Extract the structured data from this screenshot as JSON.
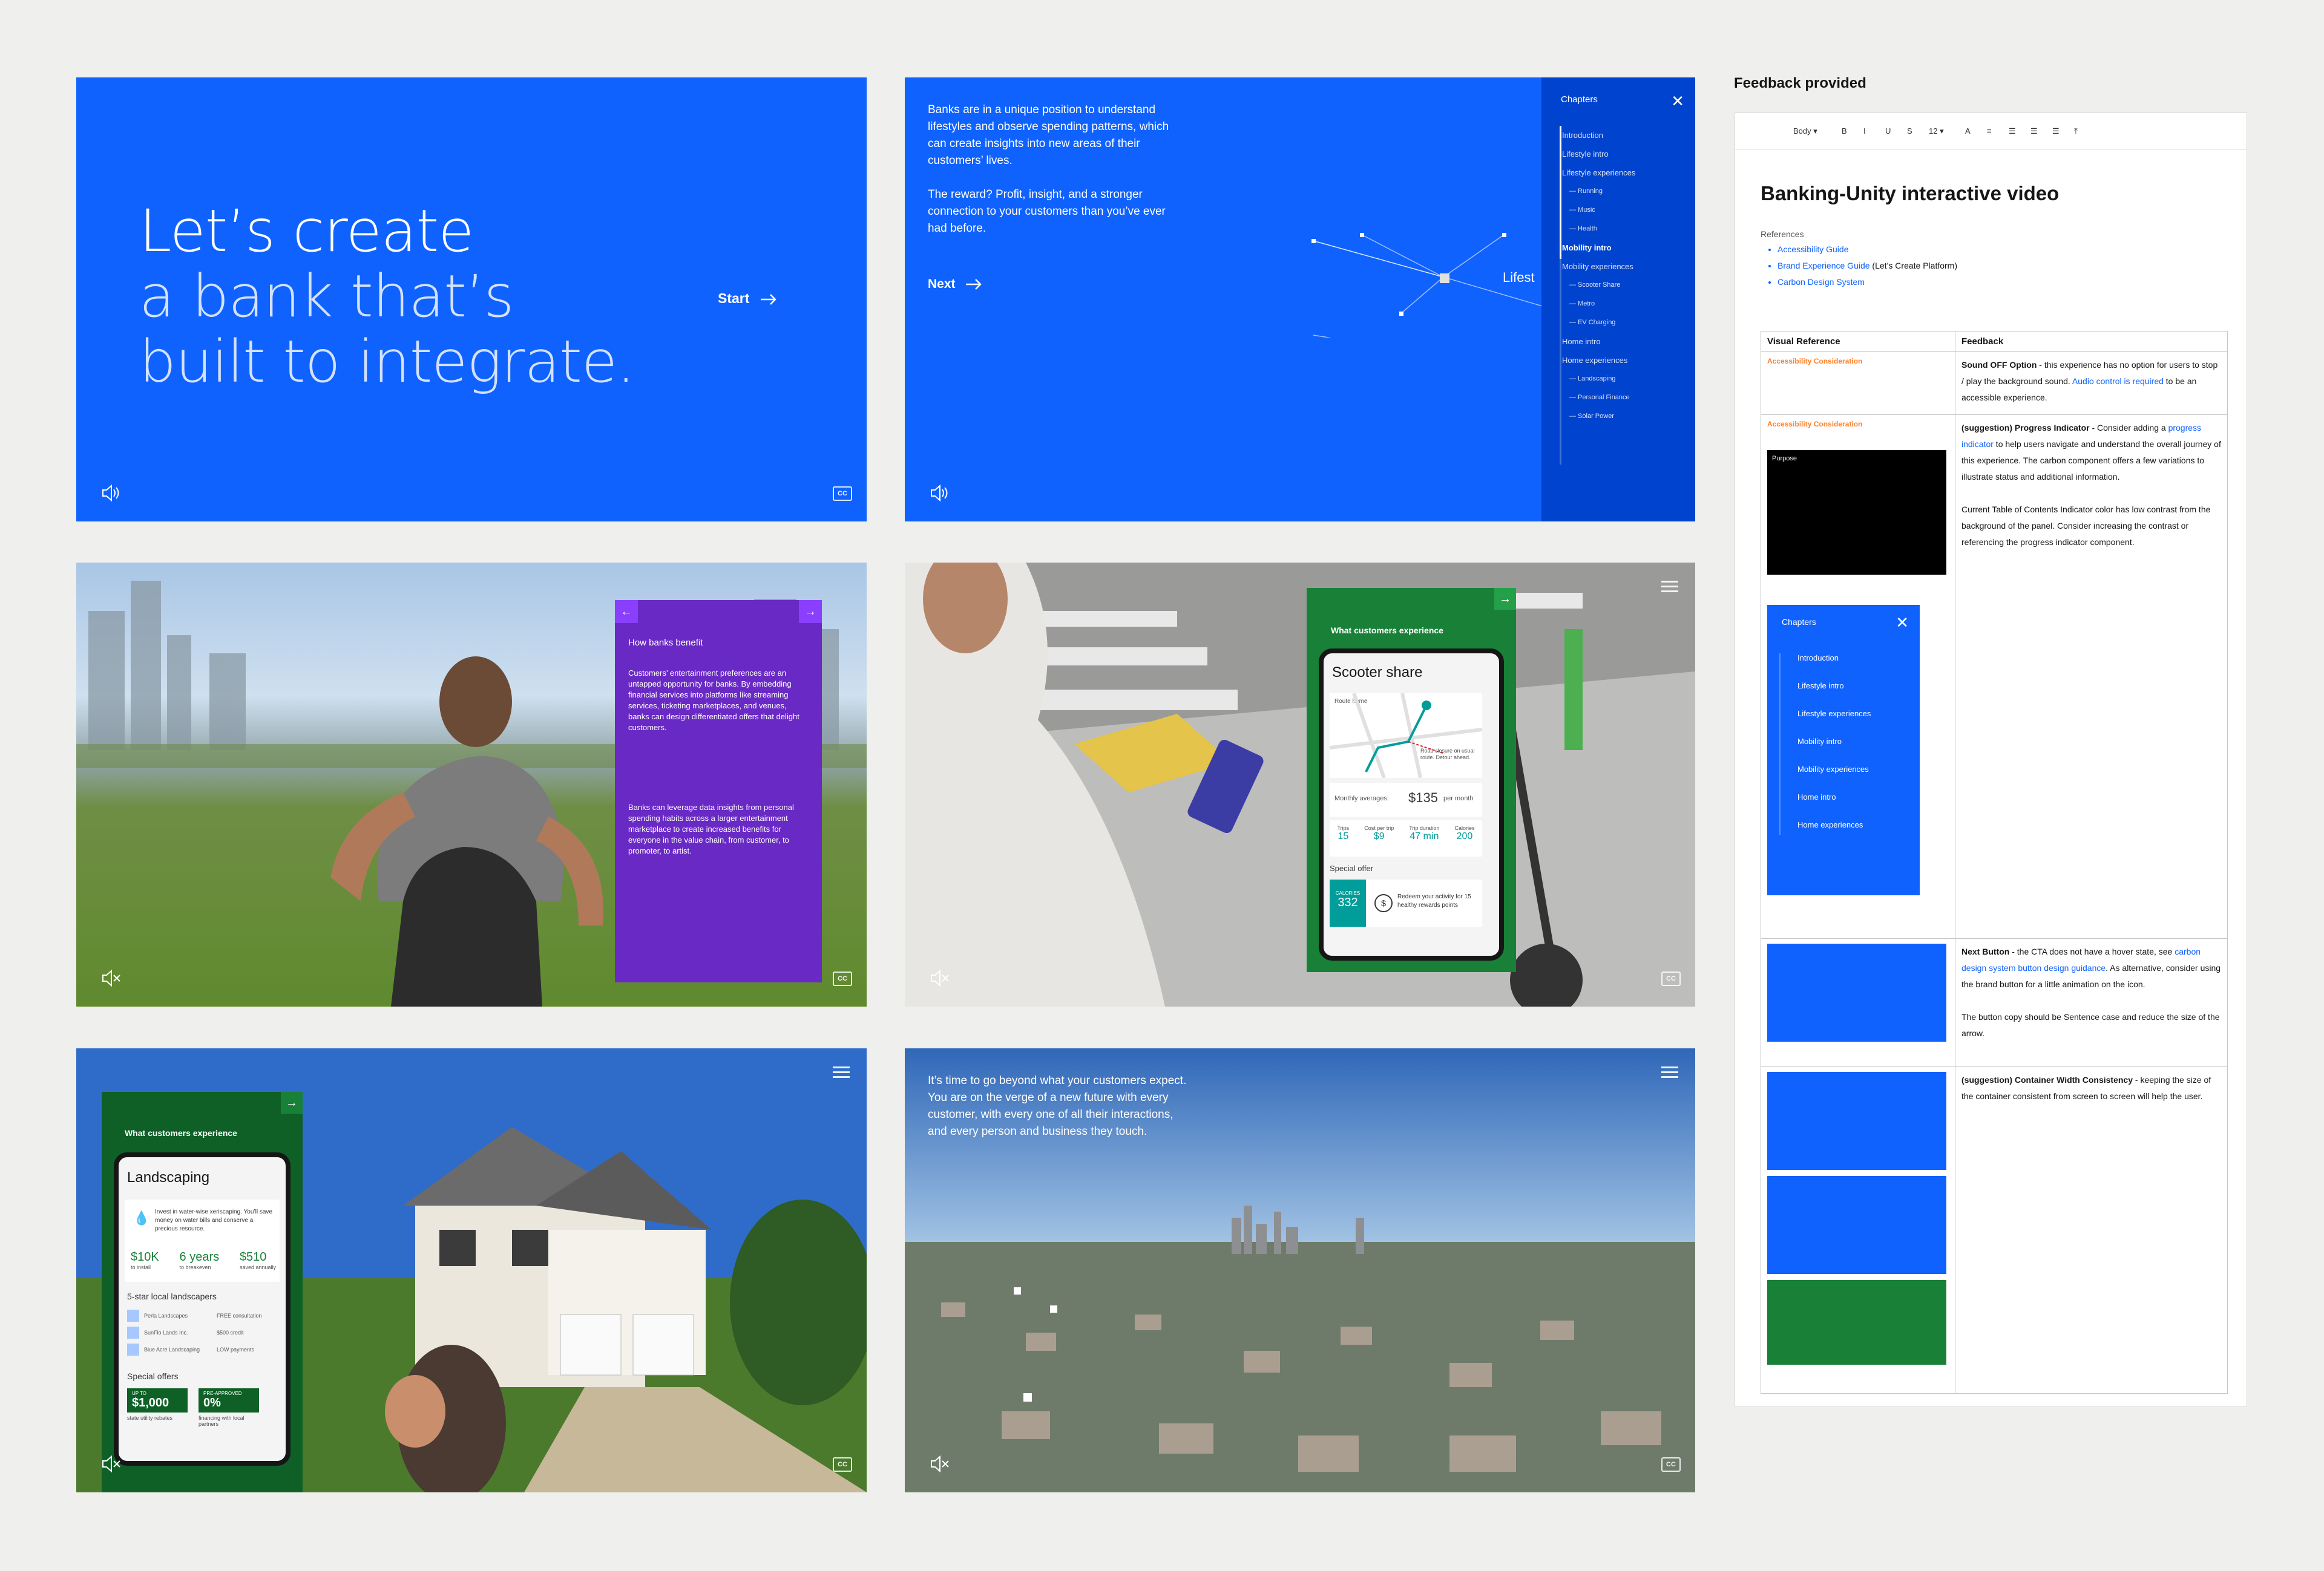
{
  "slide1": {
    "title": [
      "Let’s create",
      "a bank that’s",
      "built to integrate."
    ],
    "start": "Start",
    "arrow_icon": "arrow-right-icon",
    "sound_icon": "volume-up-icon",
    "cc": "CC"
  },
  "slide2": {
    "paragraph1": "Banks are in a unique position to understand lifestyles and observe spending patterns, which can create insights into new areas of their customers’ lives.",
    "paragraph2": "The reward? Profit, insight, and a stronger connection to your customers than you’ve ever had before.",
    "next": "Next",
    "node_label": "Lifest",
    "chapters": {
      "heading": "Chapters",
      "close_icon": "close-icon",
      "items": [
        {
          "label": "Introduction",
          "sub": false
        },
        {
          "label": "Lifestyle intro",
          "sub": false
        },
        {
          "label": "Lifestyle experiences",
          "sub": false
        },
        {
          "label": "Running",
          "sub": true
        },
        {
          "label": "Music",
          "sub": true
        },
        {
          "label": "Health",
          "sub": true
        },
        {
          "label": "Mobility intro",
          "sub": false,
          "active": true
        },
        {
          "label": "Mobility experiences",
          "sub": false
        },
        {
          "label": "Scooter Share",
          "sub": true
        },
        {
          "label": "Metro",
          "sub": true
        },
        {
          "label": "EV Charging",
          "sub": true
        },
        {
          "label": "Home intro",
          "sub": false
        },
        {
          "label": "Home experiences",
          "sub": false
        },
        {
          "label": "Landscaping",
          "sub": true
        },
        {
          "label": "Personal Finance",
          "sub": true
        },
        {
          "label": "Solar Power",
          "sub": true
        }
      ]
    }
  },
  "slide3": {
    "card_title": "How banks benefit",
    "para1": "Customers’ entertainment preferences are an untapped opportunity for banks. By embedding financial services into platforms like streaming services, ticketing marketplaces, and venues, banks can design differentiated offers that delight customers.",
    "para2": "Banks can leverage data insights from personal spending habits across a larger entertainment marketplace to create increased benefits for everyone in the value chain, from customer, to promoter, to artist.",
    "mute_icon": "volume-mute-icon",
    "cc": "CC"
  },
  "slide4": {
    "card_title": "What customers experience",
    "phone_title": "Scooter share",
    "route_label": "Route home",
    "map_note": "Road closure on usual route. Detour ahead.",
    "monthly_label": "Monthly averages:",
    "monthly_value": "$135",
    "monthly_unit": "per month",
    "stats": [
      {
        "label": "Trips",
        "value": "15"
      },
      {
        "label": "Cost per trip",
        "value": "$9"
      },
      {
        "label": "Trip duration",
        "value": "47 min"
      },
      {
        "label": "Calories",
        "value": "200"
      }
    ],
    "special_offer": "Special offer",
    "calories_badge_label": "CALORIES",
    "calories_badge_value": "332",
    "offer_text": "Redeem your activity for 15 healthy rewards points",
    "cc": "CC"
  },
  "slide5": {
    "card_title": "What customers experience",
    "phone_title": "Landscaping",
    "invest_text": "Invest in water-wise xeriscaping. You’ll save money on water bills and conserve a precious resource.",
    "stats": [
      {
        "value": "$10K",
        "label": "to install"
      },
      {
        "value": "6 years",
        "label": "to breakeven"
      },
      {
        "value": "$510",
        "label": "saved annually"
      }
    ],
    "landscapers_title": "5-star local landscapers",
    "landscapers": [
      {
        "name": "Perla Landscapes",
        "offer": "FREE consultation"
      },
      {
        "name": "SunFlo Lands Inc.",
        "offer": "$500 credit"
      },
      {
        "name": "Blue Acre Landscaping",
        "offer": "LOW payments"
      }
    ],
    "special_offers_title": "Special offers",
    "offers": [
      {
        "top": "UP TO",
        "value": "$1,000",
        "caption": "state utility rebates"
      },
      {
        "top": "PRE-APPROVED",
        "value": "0%",
        "caption": "financing with local partners"
      }
    ],
    "cc": "CC"
  },
  "slide6": {
    "paragraph": "It’s time to go beyond what your customers expect. You are on the verge of a new future with every customer, with every one of all their interactions, and every person and business they touch.",
    "cc": "CC"
  },
  "feedback": {
    "heading": "Feedback provided",
    "toolbar": [
      "Body ▾",
      "B",
      "I",
      "U",
      "S",
      "12 ▾",
      "A",
      "≡",
      "☰",
      "☰",
      "☰",
      "⤒"
    ],
    "doc_title": "Banking-Unity interactive video",
    "references_label": "References",
    "references": [
      {
        "label": "Accessibility Guide",
        "extra": ""
      },
      {
        "label": "Brand Experience Guide",
        "extra": " (Let’s Create Platform)"
      },
      {
        "label": "Carbon Design System",
        "extra": ""
      }
    ],
    "col_visual": "Visual Reference",
    "col_feedback": "Feedback",
    "rows": [
      {
        "tag": "Accessibility Consideration",
        "title": "Sound OFF Option",
        "text": " - this experience has no option for users to stop / play the background sound. ",
        "link": "Audio control is required",
        "tail": " to be an accessible experience."
      },
      {
        "tag": "Accessibility Consideration",
        "title": "(suggestion) Progress Indicator",
        "text": " - Consider adding a ",
        "link": "progress indicator",
        "tail": " to help users navigate and understand the overall journey of this experience. The carbon component offers a few variations to illustrate status and additional information.",
        "extra": "Current Table of Contents Indicator color has low contrast from the background of the panel. Consider increasing the contrast or referencing the progress indicator component.",
        "thumb_purpose": "Purpose",
        "thumb_chapters": "Chapters",
        "thumb_items": [
          "Introduction",
          "Lifestyle intro",
          "Lifestyle experiences",
          "Mobility intro",
          "Mobility experiences",
          "Home intro",
          "Home experiences"
        ]
      },
      {
        "tag": "",
        "title": "Next Button",
        "text": " - the CTA does not have a hover state, see ",
        "link": "carbon design system button design guidance",
        "tail": ". As alternative, consider using the brand button for a little animation on the icon.",
        "extra": "The button copy should be Sentence case and reduce the size of the arrow."
      },
      {
        "tag": "",
        "title": "(suggestion) Container Width Consistency",
        "text": " - keeping the size of the container consistent from screen to screen will help the user.",
        "link": "",
        "tail": ""
      }
    ]
  }
}
